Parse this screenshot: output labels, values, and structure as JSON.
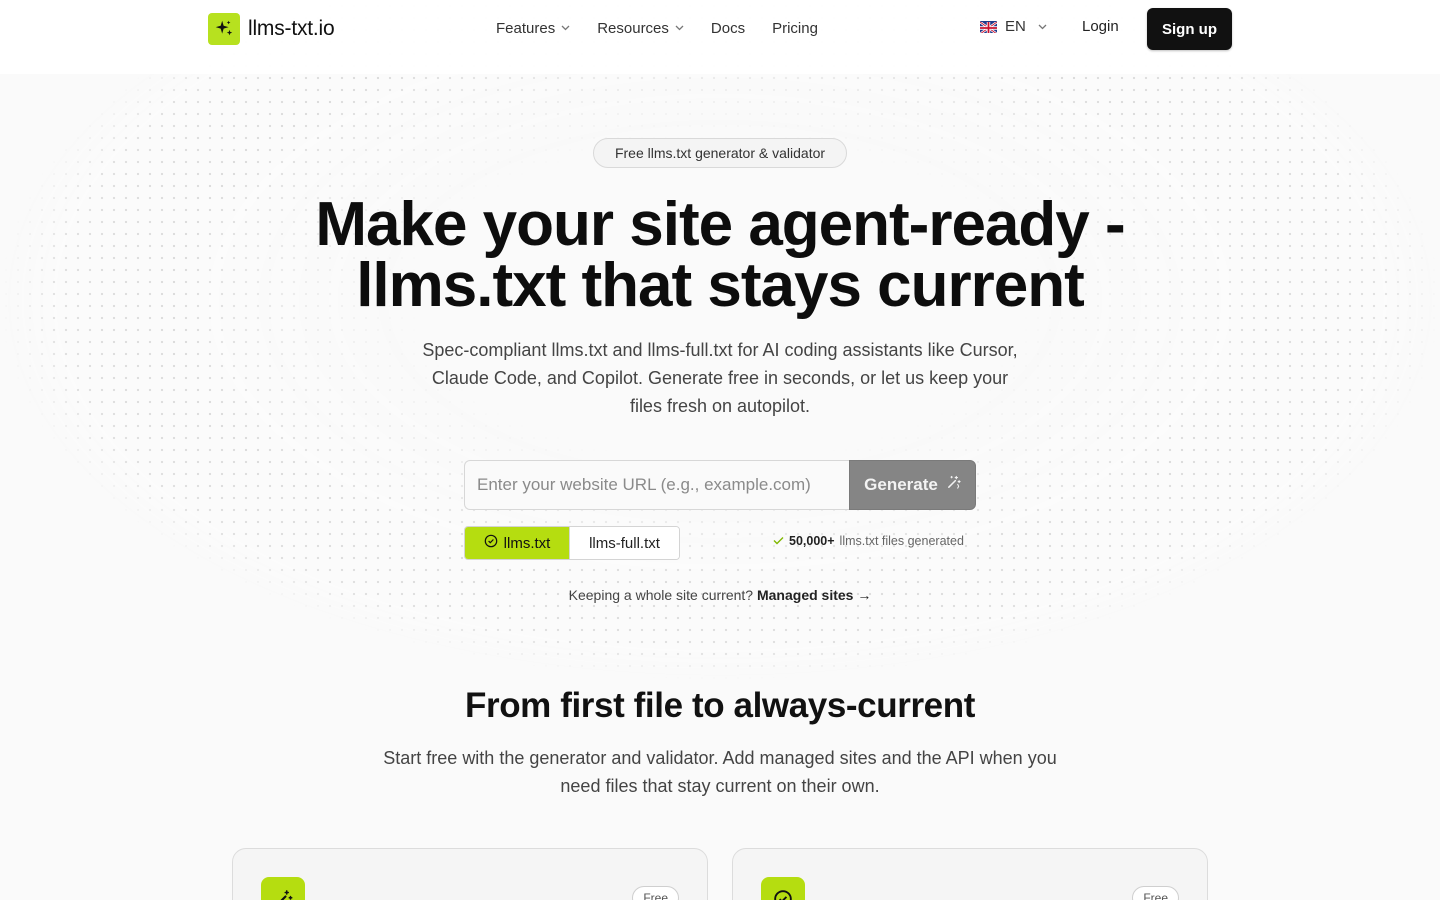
{
  "header": {
    "logo_text": "llms-txt.io",
    "nav": [
      {
        "label": "Features",
        "has_dropdown": true
      },
      {
        "label": "Resources",
        "has_dropdown": true
      },
      {
        "label": "Docs",
        "has_dropdown": false
      },
      {
        "label": "Pricing",
        "has_dropdown": false
      }
    ],
    "language": "EN",
    "login_label": "Login",
    "signup_label": "Sign up"
  },
  "hero": {
    "pill": "Free llms.txt generator & validator",
    "title_line1": "Make your site agent-ready -",
    "title_line2": "llms.txt that stays current",
    "subtitle": "Spec-compliant llms.txt and llms-full.txt for AI coding assistants like Cursor, Claude Code, and Copilot. Generate free in seconds, or let us keep your files fresh on autopilot.",
    "url_placeholder": "Enter your website URL (e.g., example.com)",
    "url_value": "",
    "generate_label": "Generate",
    "format_options": [
      "llms.txt",
      "llms-full.txt"
    ],
    "selected_format": "llms.txt",
    "stat_count": "50,000+",
    "stat_text": "llms.txt files generated",
    "managed_prefix": "Keeping a whole site current?",
    "managed_link": "Managed sites",
    "managed_arrow": "→"
  },
  "section": {
    "title": "From first file to always-current",
    "subtitle": "Start free with the generator and validator. Add managed sites and the API when you need files that stay current on their own.",
    "cards": [
      {
        "badge": "Free",
        "icon": "magic-wand-icon"
      },
      {
        "badge": "Free",
        "icon": "check-circle-icon"
      }
    ]
  },
  "colors": {
    "accent": "#b5dd10",
    "dark": "#111111"
  }
}
